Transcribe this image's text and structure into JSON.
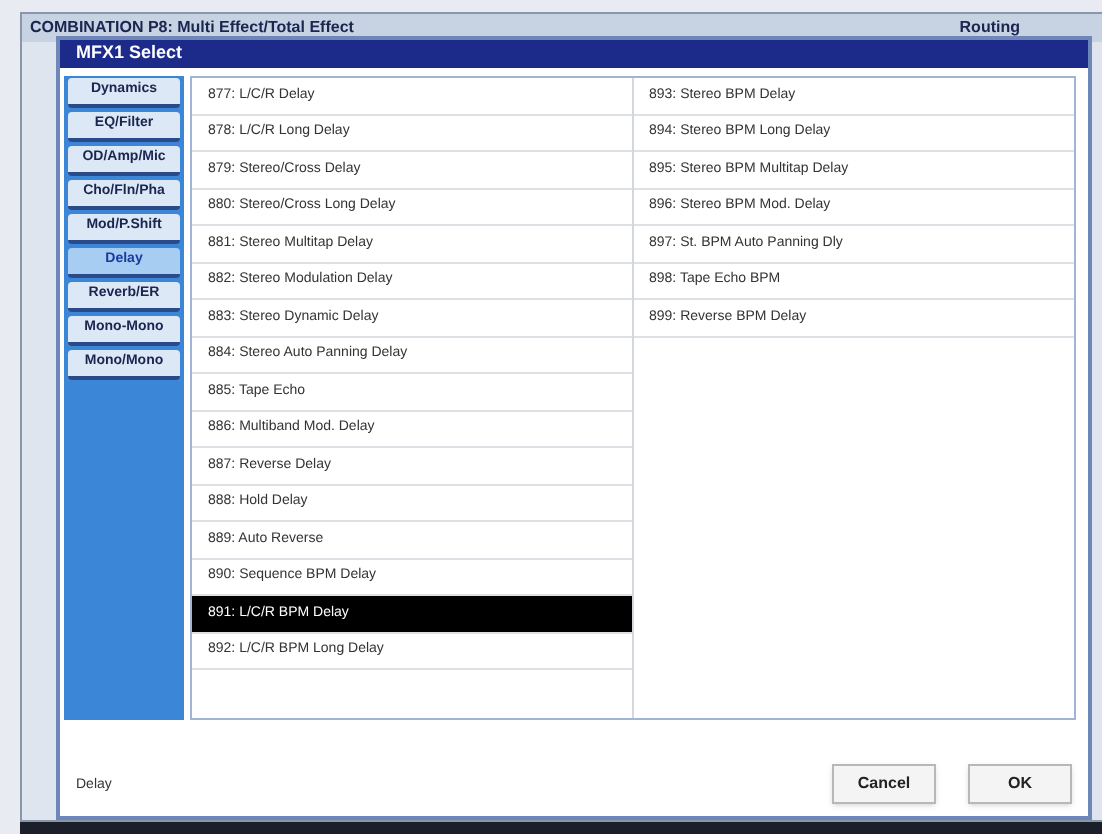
{
  "background_window": {
    "title": "COMBINATION P8: Multi Effect/Total Effect",
    "tab": "Routing"
  },
  "dialog": {
    "title": "MFX1 Select",
    "categories": [
      {
        "label": "Dynamics",
        "selected": false
      },
      {
        "label": "EQ/Filter",
        "selected": false
      },
      {
        "label": "OD/Amp/Mic",
        "selected": false
      },
      {
        "label": "Cho/Fln/Pha",
        "selected": false
      },
      {
        "label": "Mod/P.Shift",
        "selected": false
      },
      {
        "label": "Delay",
        "selected": true
      },
      {
        "label": "Reverb/ER",
        "selected": false
      },
      {
        "label": "Mono-Mono",
        "selected": false
      },
      {
        "label": "Mono/Mono",
        "selected": false
      }
    ],
    "effects": [
      [
        {
          "label": "877: L/C/R Delay",
          "selected": false
        },
        {
          "label": "878: L/C/R Long Delay",
          "selected": false
        },
        {
          "label": "879: Stereo/Cross Delay",
          "selected": false
        },
        {
          "label": "880: Stereo/Cross Long Delay",
          "selected": false
        },
        {
          "label": "881: Stereo Multitap Delay",
          "selected": false
        },
        {
          "label": "882: Stereo Modulation Delay",
          "selected": false
        },
        {
          "label": "883: Stereo Dynamic Delay",
          "selected": false
        },
        {
          "label": "884: Stereo Auto Panning Delay",
          "selected": false
        },
        {
          "label": "885: Tape Echo",
          "selected": false
        },
        {
          "label": "886: Multiband Mod. Delay",
          "selected": false
        },
        {
          "label": "887: Reverse Delay",
          "selected": false
        },
        {
          "label": "888: Hold Delay",
          "selected": false
        },
        {
          "label": "889: Auto Reverse",
          "selected": false
        },
        {
          "label": "890: Sequence BPM Delay",
          "selected": false
        },
        {
          "label": "891: L/C/R BPM Delay",
          "selected": true
        },
        {
          "label": "892: L/C/R BPM Long Delay",
          "selected": false
        }
      ],
      [
        {
          "label": "893: Stereo BPM Delay",
          "selected": false
        },
        {
          "label": "894: Stereo BPM Long Delay",
          "selected": false
        },
        {
          "label": "895: Stereo BPM Multitap Delay",
          "selected": false
        },
        {
          "label": "896: Stereo BPM Mod. Delay",
          "selected": false
        },
        {
          "label": "897: St. BPM Auto Panning Dly",
          "selected": false
        },
        {
          "label": "898: Tape Echo BPM",
          "selected": false
        },
        {
          "label": "899: Reverse BPM Delay",
          "selected": false
        }
      ]
    ],
    "status": "Delay",
    "buttons": [
      "Cancel",
      "OK"
    ]
  }
}
